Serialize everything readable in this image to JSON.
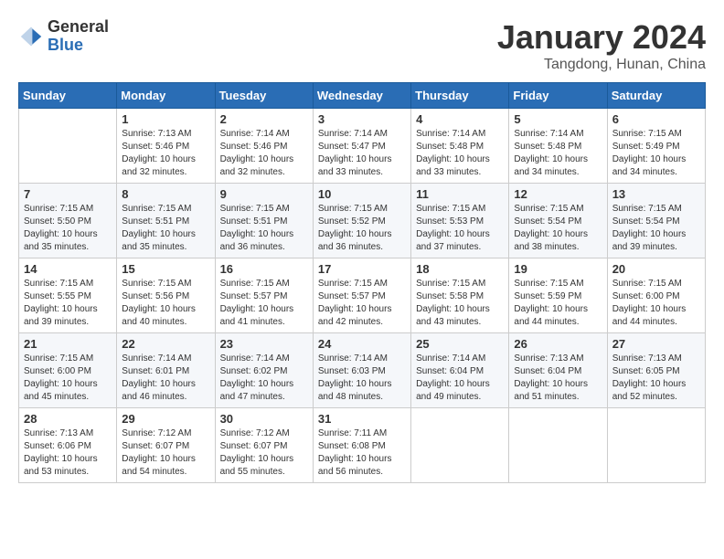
{
  "header": {
    "logo_general": "General",
    "logo_blue": "Blue",
    "month_title": "January 2024",
    "location": "Tangdong, Hunan, China"
  },
  "weekdays": [
    "Sunday",
    "Monday",
    "Tuesday",
    "Wednesday",
    "Thursday",
    "Friday",
    "Saturday"
  ],
  "weeks": [
    [
      {
        "day": "",
        "sunrise": "",
        "sunset": "",
        "daylight": ""
      },
      {
        "day": "1",
        "sunrise": "Sunrise: 7:13 AM",
        "sunset": "Sunset: 5:46 PM",
        "daylight": "Daylight: 10 hours and 32 minutes."
      },
      {
        "day": "2",
        "sunrise": "Sunrise: 7:14 AM",
        "sunset": "Sunset: 5:46 PM",
        "daylight": "Daylight: 10 hours and 32 minutes."
      },
      {
        "day": "3",
        "sunrise": "Sunrise: 7:14 AM",
        "sunset": "Sunset: 5:47 PM",
        "daylight": "Daylight: 10 hours and 33 minutes."
      },
      {
        "day": "4",
        "sunrise": "Sunrise: 7:14 AM",
        "sunset": "Sunset: 5:48 PM",
        "daylight": "Daylight: 10 hours and 33 minutes."
      },
      {
        "day": "5",
        "sunrise": "Sunrise: 7:14 AM",
        "sunset": "Sunset: 5:48 PM",
        "daylight": "Daylight: 10 hours and 34 minutes."
      },
      {
        "day": "6",
        "sunrise": "Sunrise: 7:15 AM",
        "sunset": "Sunset: 5:49 PM",
        "daylight": "Daylight: 10 hours and 34 minutes."
      }
    ],
    [
      {
        "day": "7",
        "sunrise": "Sunrise: 7:15 AM",
        "sunset": "Sunset: 5:50 PM",
        "daylight": "Daylight: 10 hours and 35 minutes."
      },
      {
        "day": "8",
        "sunrise": "Sunrise: 7:15 AM",
        "sunset": "Sunset: 5:51 PM",
        "daylight": "Daylight: 10 hours and 35 minutes."
      },
      {
        "day": "9",
        "sunrise": "Sunrise: 7:15 AM",
        "sunset": "Sunset: 5:51 PM",
        "daylight": "Daylight: 10 hours and 36 minutes."
      },
      {
        "day": "10",
        "sunrise": "Sunrise: 7:15 AM",
        "sunset": "Sunset: 5:52 PM",
        "daylight": "Daylight: 10 hours and 36 minutes."
      },
      {
        "day": "11",
        "sunrise": "Sunrise: 7:15 AM",
        "sunset": "Sunset: 5:53 PM",
        "daylight": "Daylight: 10 hours and 37 minutes."
      },
      {
        "day": "12",
        "sunrise": "Sunrise: 7:15 AM",
        "sunset": "Sunset: 5:54 PM",
        "daylight": "Daylight: 10 hours and 38 minutes."
      },
      {
        "day": "13",
        "sunrise": "Sunrise: 7:15 AM",
        "sunset": "Sunset: 5:54 PM",
        "daylight": "Daylight: 10 hours and 39 minutes."
      }
    ],
    [
      {
        "day": "14",
        "sunrise": "Sunrise: 7:15 AM",
        "sunset": "Sunset: 5:55 PM",
        "daylight": "Daylight: 10 hours and 39 minutes."
      },
      {
        "day": "15",
        "sunrise": "Sunrise: 7:15 AM",
        "sunset": "Sunset: 5:56 PM",
        "daylight": "Daylight: 10 hours and 40 minutes."
      },
      {
        "day": "16",
        "sunrise": "Sunrise: 7:15 AM",
        "sunset": "Sunset: 5:57 PM",
        "daylight": "Daylight: 10 hours and 41 minutes."
      },
      {
        "day": "17",
        "sunrise": "Sunrise: 7:15 AM",
        "sunset": "Sunset: 5:57 PM",
        "daylight": "Daylight: 10 hours and 42 minutes."
      },
      {
        "day": "18",
        "sunrise": "Sunrise: 7:15 AM",
        "sunset": "Sunset: 5:58 PM",
        "daylight": "Daylight: 10 hours and 43 minutes."
      },
      {
        "day": "19",
        "sunrise": "Sunrise: 7:15 AM",
        "sunset": "Sunset: 5:59 PM",
        "daylight": "Daylight: 10 hours and 44 minutes."
      },
      {
        "day": "20",
        "sunrise": "Sunrise: 7:15 AM",
        "sunset": "Sunset: 6:00 PM",
        "daylight": "Daylight: 10 hours and 44 minutes."
      }
    ],
    [
      {
        "day": "21",
        "sunrise": "Sunrise: 7:15 AM",
        "sunset": "Sunset: 6:00 PM",
        "daylight": "Daylight: 10 hours and 45 minutes."
      },
      {
        "day": "22",
        "sunrise": "Sunrise: 7:14 AM",
        "sunset": "Sunset: 6:01 PM",
        "daylight": "Daylight: 10 hours and 46 minutes."
      },
      {
        "day": "23",
        "sunrise": "Sunrise: 7:14 AM",
        "sunset": "Sunset: 6:02 PM",
        "daylight": "Daylight: 10 hours and 47 minutes."
      },
      {
        "day": "24",
        "sunrise": "Sunrise: 7:14 AM",
        "sunset": "Sunset: 6:03 PM",
        "daylight": "Daylight: 10 hours and 48 minutes."
      },
      {
        "day": "25",
        "sunrise": "Sunrise: 7:14 AM",
        "sunset": "Sunset: 6:04 PM",
        "daylight": "Daylight: 10 hours and 49 minutes."
      },
      {
        "day": "26",
        "sunrise": "Sunrise: 7:13 AM",
        "sunset": "Sunset: 6:04 PM",
        "daylight": "Daylight: 10 hours and 51 minutes."
      },
      {
        "day": "27",
        "sunrise": "Sunrise: 7:13 AM",
        "sunset": "Sunset: 6:05 PM",
        "daylight": "Daylight: 10 hours and 52 minutes."
      }
    ],
    [
      {
        "day": "28",
        "sunrise": "Sunrise: 7:13 AM",
        "sunset": "Sunset: 6:06 PM",
        "daylight": "Daylight: 10 hours and 53 minutes."
      },
      {
        "day": "29",
        "sunrise": "Sunrise: 7:12 AM",
        "sunset": "Sunset: 6:07 PM",
        "daylight": "Daylight: 10 hours and 54 minutes."
      },
      {
        "day": "30",
        "sunrise": "Sunrise: 7:12 AM",
        "sunset": "Sunset: 6:07 PM",
        "daylight": "Daylight: 10 hours and 55 minutes."
      },
      {
        "day": "31",
        "sunrise": "Sunrise: 7:11 AM",
        "sunset": "Sunset: 6:08 PM",
        "daylight": "Daylight: 10 hours and 56 minutes."
      },
      {
        "day": "",
        "sunrise": "",
        "sunset": "",
        "daylight": ""
      },
      {
        "day": "",
        "sunrise": "",
        "sunset": "",
        "daylight": ""
      },
      {
        "day": "",
        "sunrise": "",
        "sunset": "",
        "daylight": ""
      }
    ]
  ]
}
